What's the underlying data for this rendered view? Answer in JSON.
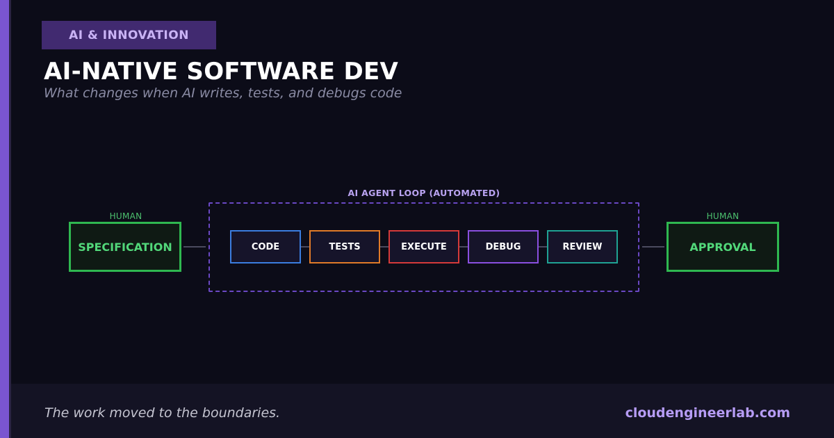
{
  "badge": "AI & INNOVATION",
  "title": "AI-NATIVE SOFTWARE DEV",
  "subtitle": "What changes when AI writes, tests, and debugs code",
  "diagram": {
    "loop_label": "AI AGENT LOOP (AUTOMATED)",
    "left_endpoint": {
      "role": "HUMAN",
      "label": "SPECIFICATION",
      "color": "#2fb850"
    },
    "right_endpoint": {
      "role": "HUMAN",
      "label": "APPROVAL",
      "color": "#2fb850"
    },
    "steps": [
      {
        "label": "CODE",
        "color": "#3b7de0"
      },
      {
        "label": "TESTS",
        "color": "#e07a28"
      },
      {
        "label": "EXECUTE",
        "color": "#d63a3a"
      },
      {
        "label": "DEBUG",
        "color": "#8a4fe0"
      },
      {
        "label": "REVIEW",
        "color": "#1fa394"
      }
    ],
    "loop_border_color": "#6a48c4"
  },
  "footer": {
    "tagline": "The work moved to the boundaries.",
    "site": "cloudengineerlab.com"
  },
  "colors": {
    "background": "#0c0c18",
    "accent": "#7a55d0",
    "badge_bg": "#412a70"
  }
}
